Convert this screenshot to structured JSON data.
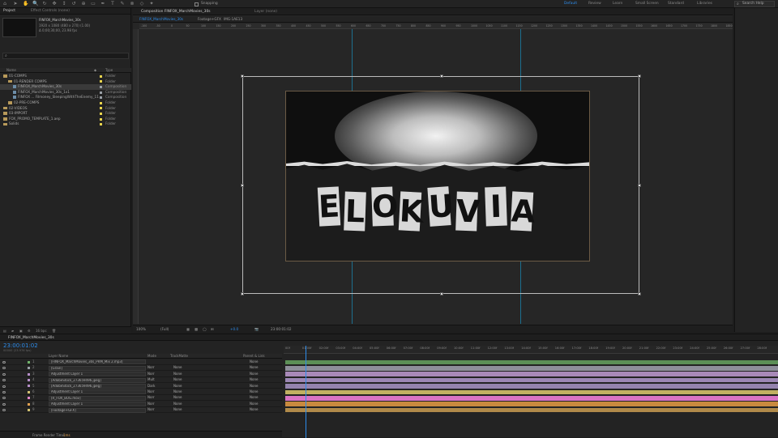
{
  "toolbar": {
    "snapping_label": "Snapping",
    "workspaces": [
      "Default",
      "Review",
      "Learn",
      "Small Screen",
      "Standard",
      "Libraries"
    ],
    "active_workspace": "Default",
    "search_placeholder": "Search Help"
  },
  "project": {
    "tab_project": "Project",
    "tab_effect_controls": "Effect Controls (none)",
    "selected_name": "FINFOX_MarchMovies_30s",
    "selected_info_1": "1920 x 1080 (480 x 270) (1.00)",
    "selected_info_2": "Δ 0;00;30;00, 23.98 fps",
    "search_placeholder": "",
    "col_name": "Name",
    "col_type": "Type",
    "items": [
      {
        "name": "01-COMPS",
        "type": "Folder",
        "indent": 0,
        "kind": "folder",
        "color": "#e8d44d"
      },
      {
        "name": "01-RENDER COMPS",
        "type": "Folder",
        "indent": 1,
        "kind": "folder",
        "color": "#e8d44d"
      },
      {
        "name": "FINFOX_MarchMovies_30s",
        "type": "Composition",
        "indent": 2,
        "kind": "comp",
        "color": "#9aa0a6",
        "selected": true
      },
      {
        "name": "FINFOX_MarchMovies_30s_1x1",
        "type": "Composition",
        "indent": 2,
        "kind": "comp",
        "color": "#9aa0a6"
      },
      {
        "name": "FINFOX ... Filmoney_SleepingWithTheEnemy_11",
        "type": "Composition",
        "indent": 2,
        "kind": "comp",
        "color": "#9aa0a6"
      },
      {
        "name": "02-PRE-COMPS",
        "type": "Folder",
        "indent": 1,
        "kind": "folder",
        "color": "#e8d44d"
      },
      {
        "name": "02-VIDEOS",
        "type": "Folder",
        "indent": 0,
        "kind": "folder",
        "color": "#e8d44d"
      },
      {
        "name": "03-IMPORT",
        "type": "Folder",
        "indent": 0,
        "kind": "folder",
        "color": "#e8d44d"
      },
      {
        "name": "FOX_PROMO_TEMPLATE_1.aep",
        "type": "Folder",
        "indent": 0,
        "kind": "folder",
        "color": "#e8d44d"
      },
      {
        "name": "Solids",
        "type": "Folder",
        "indent": 0,
        "kind": "folder",
        "color": "#e8d44d"
      }
    ],
    "footer_bpc": "16 bpc"
  },
  "composition": {
    "panel_title": "Composition FINFOX_MarchMovies_30s",
    "layer_tab": "Layer (none)",
    "sub_tabs": [
      "FINFOX_MarchMovies_30s",
      "Footage+GFX",
      "IMG-1AE13"
    ],
    "zoom": "100%",
    "resolution": "(Full)",
    "exposure": "+0.0",
    "timecode": "23:00:01:02",
    "artwork_letters": [
      "E",
      "L",
      "O",
      "K",
      "U",
      "V",
      "I",
      "A"
    ],
    "ruler_ticks": [
      "-100",
      "-50",
      "0",
      "50",
      "100",
      "150",
      "200",
      "250",
      "300",
      "350",
      "400",
      "450",
      "500",
      "550",
      "600",
      "650",
      "700",
      "750",
      "800",
      "850",
      "900",
      "950",
      "1000",
      "1050",
      "1100",
      "1150",
      "1200",
      "1250",
      "1300",
      "1350",
      "1400",
      "1450",
      "1500",
      "1550",
      "1600",
      "1650",
      "1700",
      "1750",
      "1800",
      "1850"
    ]
  },
  "timeline": {
    "tab_label": "FINFOX_MarchMovies_30s",
    "timecode": "23:00:01:02",
    "fps_info": "00000 (23.976 fps)",
    "col_layer_name": "Layer Name",
    "col_mode": "Mode",
    "col_trkmat": "TrackMatte",
    "col_parent": "Parent & Link",
    "time_ticks": [
      "00f",
      "01:00f",
      "02:00f",
      "03:00f",
      "04:00f",
      "05:00f",
      "06:00f",
      "07:00f",
      "08:00f",
      "09:00f",
      "10:00f",
      "11:00f",
      "12:00f",
      "13:00f",
      "14:00f",
      "15:00f",
      "16:00f",
      "17:00f",
      "18:00f",
      "19:00f",
      "20:00f",
      "21:00f",
      "22:00f",
      "23:00f",
      "24:00f",
      "25:00f",
      "26:00f",
      "27:00f",
      "28:00f"
    ],
    "layers": [
      {
        "num": "1",
        "name": "[FINFOX_MarchMovies_30s_PRM_Mix 2.mp3]",
        "mode": "",
        "trkmat": "",
        "parent": "None",
        "color": "#6fb36a",
        "bar_color": "#5c8f56"
      },
      {
        "num": "2",
        "name": "[Grain]",
        "mode": "Norr",
        "trkmat": "None",
        "parent": "None",
        "color": "#9aa0a6",
        "bar_color": "#8e8e9a"
      },
      {
        "num": "3",
        "name": "Adjustment Layer 1",
        "mode": "Norr",
        "trkmat": "None",
        "parent": "None",
        "color": "#b68ec9",
        "bar_color": "#a889b8"
      },
      {
        "num": "4",
        "name": "[AdobeStock_273659496.jpeg]",
        "mode": "Mult",
        "trkmat": "None",
        "parent": "None",
        "color": "#b68ec9",
        "bar_color": "#9c87b4"
      },
      {
        "num": "5",
        "name": "[AdobeStock_273659496.jpeg]",
        "mode": "Dark",
        "trkmat": "None",
        "parent": "None",
        "color": "#b68ec9",
        "bar_color": "#9483ad"
      },
      {
        "num": "6",
        "name": "Adjustment Layer 1",
        "mode": "Norr",
        "trkmat": "None",
        "parent": "None",
        "color": "#d0c070",
        "bar_color": "#c1b062"
      },
      {
        "num": "7",
        "name": "[R_FOX_BUG.mov]",
        "mode": "Norr",
        "trkmat": "None",
        "parent": "None",
        "color": "#e086c9",
        "bar_color": "#d873c4"
      },
      {
        "num": "8",
        "name": "Adjustment Layer 1",
        "mode": "Norr",
        "trkmat": "None",
        "parent": "None",
        "color": "#e0a050",
        "bar_color": "#c98a3e"
      },
      {
        "num": "9",
        "name": "[Footage+GFX]",
        "mode": "Norr",
        "trkmat": "None",
        "parent": "None",
        "color": "#d0c070",
        "bar_color": "#b08a4a"
      }
    ],
    "footer_label": "Frame Render Time",
    "footer_value": "1ms"
  }
}
